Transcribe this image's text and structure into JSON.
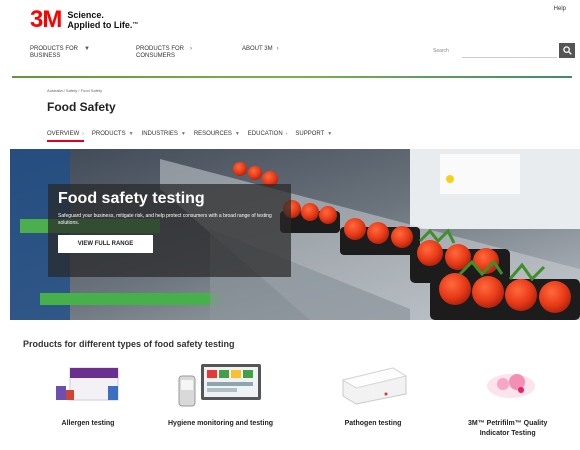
{
  "brand": {
    "logo": "3M",
    "tagline_line1": "Science.",
    "tagline_line2": "Applied to Life.",
    "trademark": "™",
    "logo_color": "#ff0000"
  },
  "utility": {
    "help": "Help"
  },
  "main_nav": {
    "items": [
      {
        "line1": "PRODUCTS FOR",
        "line2": "BUSINESS",
        "icon": "caret-down-icon"
      },
      {
        "line1": "PRODUCTS FOR",
        "line2": "CONSUMERS",
        "icon": "chevron-right-icon"
      },
      {
        "line1": "ABOUT 3M",
        "line2": "",
        "icon": "chevron-right-icon"
      }
    ]
  },
  "search": {
    "label": "Search",
    "icon": "search-icon"
  },
  "breadcrumb": {
    "text": "Australia / Safety / Food Safety"
  },
  "page": {
    "title": "Food Safety"
  },
  "sub_nav": {
    "tabs": [
      {
        "label": "OVERVIEW",
        "icon": "chevron-right-icon",
        "active": true
      },
      {
        "label": "PRODUCTS",
        "icon": "caret-down-icon"
      },
      {
        "label": "INDUSTRIES",
        "icon": "caret-down-icon"
      },
      {
        "label": "RESOURCES",
        "icon": "caret-down-icon"
      },
      {
        "label": "EDUCATION",
        "icon": "chevron-right-icon"
      },
      {
        "label": "SUPPORT",
        "icon": "caret-down-icon"
      }
    ],
    "active_color": "#e2001a"
  },
  "hero": {
    "title": "Food safety testing",
    "subtitle": "Safeguard your business, mitigate risk, and help protect consumers with a broad range of testing solutions.",
    "button": "VIEW FULL RANGE"
  },
  "products_section": {
    "title": "Products for different types of food safety testing",
    "items": [
      {
        "label": "Allergen testing"
      },
      {
        "label": "Hygiene monitoring and testing"
      },
      {
        "label": "Pathogen testing"
      },
      {
        "label_line1": "3M™ Petrifilm™ Quality",
        "label_line2": "Indicator Testing"
      }
    ]
  },
  "colors": {
    "nav_rule": "#5a9b3e",
    "accent": "#e2001a"
  }
}
